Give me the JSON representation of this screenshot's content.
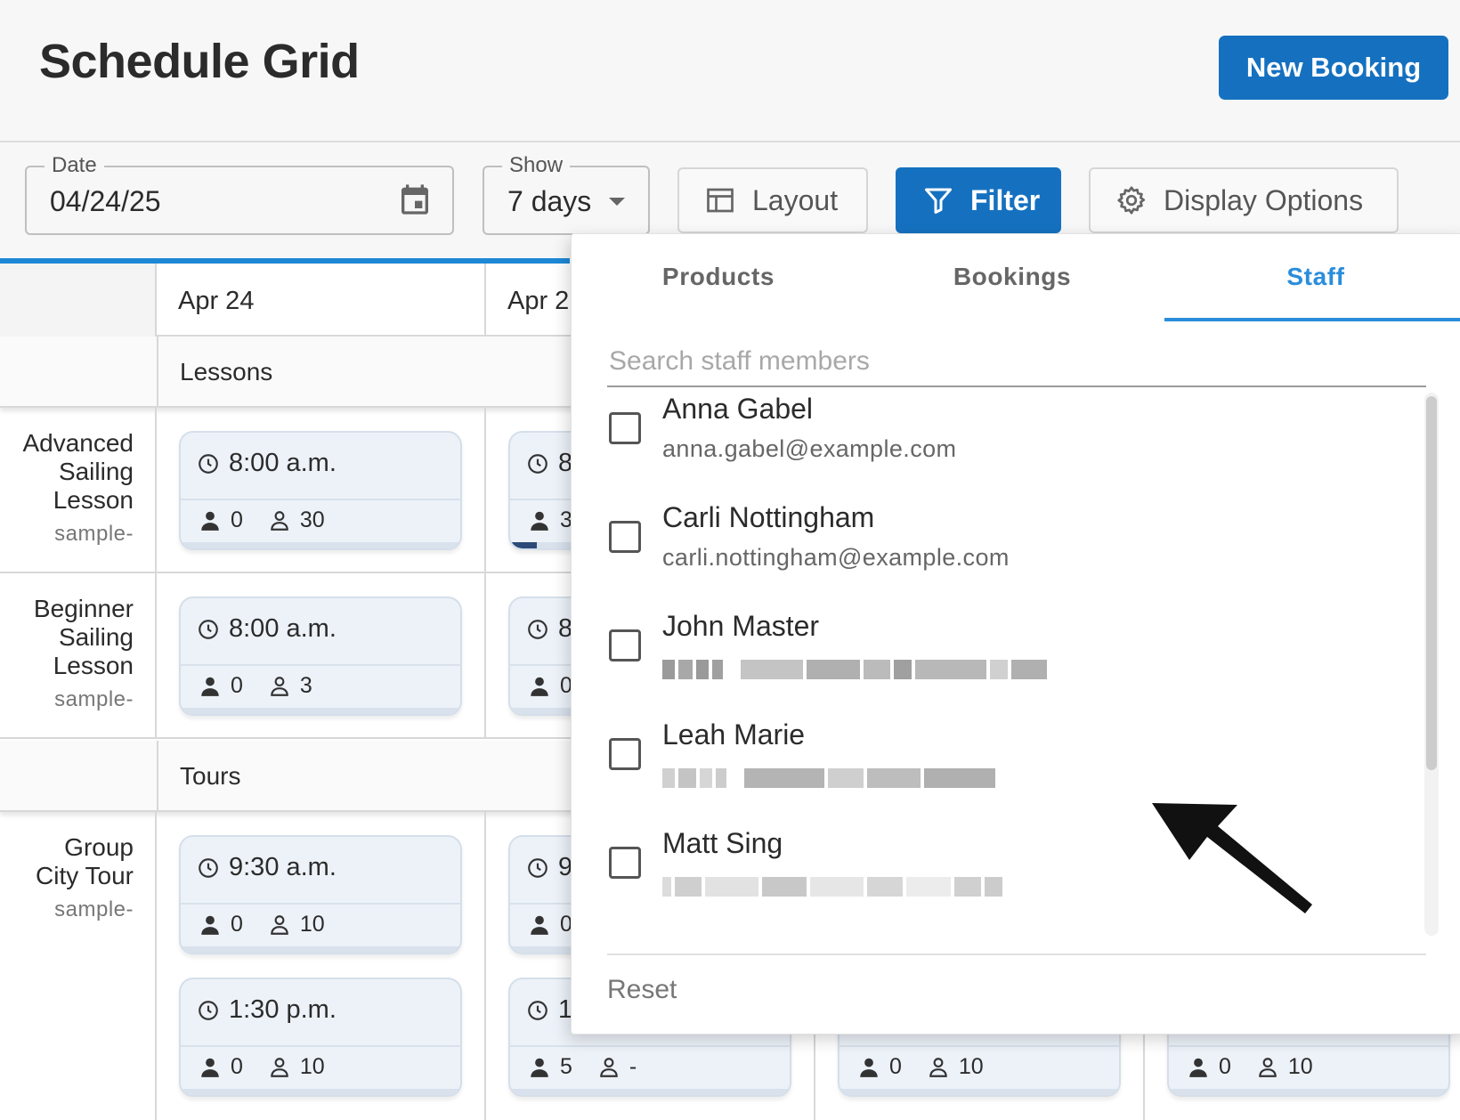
{
  "header": {
    "title": "Schedule Grid",
    "new_booking_label": "New Booking"
  },
  "toolbar": {
    "date_label": "Date",
    "date_value": "04/24/25",
    "show_label": "Show",
    "show_value": "7 days",
    "layout_label": "Layout",
    "filter_label": "Filter",
    "display_options_label": "Display Options"
  },
  "grid": {
    "dates": [
      "Apr 24",
      "Apr 2"
    ],
    "sections": [
      "Lessons",
      "Tours"
    ],
    "products": [
      {
        "name_lines": [
          "Advanced",
          "Sailing",
          "Lesson"
        ],
        "sub": "sample-"
      },
      {
        "name_lines": [
          "Beginner",
          "Sailing",
          "Lesson"
        ],
        "sub": "sample-"
      },
      {
        "name_lines": [
          "Group",
          "City Tour"
        ],
        "sub": "sample-"
      }
    ],
    "slots": [
      {
        "time": "8:00 a.m.",
        "booked": "0",
        "capacity": "30"
      },
      {
        "time": "8",
        "booked": "3",
        "capacity": ""
      },
      {
        "time": "8:00 a.m.",
        "booked": "0",
        "capacity": "3"
      },
      {
        "time": "8",
        "booked": "0",
        "capacity": ""
      },
      {
        "time": "9:30 a.m.",
        "booked": "0",
        "capacity": "10"
      },
      {
        "time": "9",
        "booked": "0",
        "capacity": ""
      },
      {
        "time": "1:30 p.m.",
        "booked": "0",
        "capacity": "10"
      },
      {
        "time": "1",
        "booked": "5",
        "capacity": "-"
      },
      {
        "time": "",
        "booked": "0",
        "capacity": "10"
      },
      {
        "time": "",
        "booked": "0",
        "capacity": "10"
      }
    ]
  },
  "filter_panel": {
    "tabs": [
      "Products",
      "Bookings",
      "Staff"
    ],
    "active_tab": "Staff",
    "search_placeholder": "Search staff members",
    "staff": [
      {
        "name": "Anna Gabel",
        "email": "anna.gabel@example.com",
        "checked": false
      },
      {
        "name": "Carli Nottingham",
        "email": "carli.nottingham@example.com",
        "checked": false
      },
      {
        "name": "John Master",
        "email": "",
        "checked": false
      },
      {
        "name": "Leah Marie",
        "email": "",
        "checked": false
      },
      {
        "name": "Matt Sing",
        "email": "",
        "checked": false
      }
    ],
    "reset_label": "Reset"
  },
  "colors": {
    "primary": "#1571c0",
    "tab_active": "#2a8ddb",
    "slot_bg": "#edf2f9"
  }
}
